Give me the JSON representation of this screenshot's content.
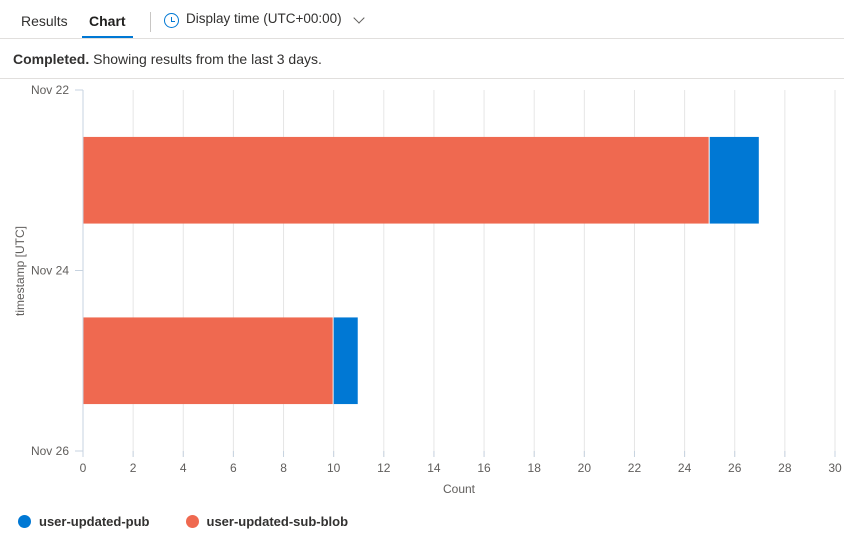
{
  "tabs": [
    {
      "label": "Results",
      "active": false
    },
    {
      "label": "Chart",
      "active": true
    }
  ],
  "display_time": {
    "label": "Display time (UTC+00:00)",
    "icon": "clock-icon"
  },
  "status": {
    "bold": "Completed.",
    "text": " Showing results from the last 3 days."
  },
  "colors": {
    "pub": "#0078d4",
    "sub_blob": "#ef6950",
    "accent": "#0078d4"
  },
  "chart_data": {
    "type": "bar",
    "orientation": "horizontal",
    "stacked": true,
    "title": "",
    "xlabel": "Count",
    "ylabel": "timestamp [UTC]",
    "xlim": [
      0,
      30
    ],
    "xticks": [
      0,
      2,
      4,
      6,
      8,
      10,
      12,
      14,
      16,
      18,
      20,
      22,
      24,
      26,
      28,
      30
    ],
    "ylim": [
      "Nov 22",
      "Nov 26"
    ],
    "yticks": [
      "Nov 22",
      "Nov 24",
      "Nov 26"
    ],
    "grid": true,
    "legend_position": "bottom-left",
    "categories": [
      "Nov 23",
      "Nov 25"
    ],
    "series": [
      {
        "name": "user-updated-sub-blob",
        "color": "#ef6950",
        "values": [
          25,
          10
        ]
      },
      {
        "name": "user-updated-pub",
        "color": "#0078d4",
        "values": [
          2,
          1
        ]
      }
    ],
    "legend": [
      "user-updated-pub",
      "user-updated-sub-blob"
    ]
  }
}
